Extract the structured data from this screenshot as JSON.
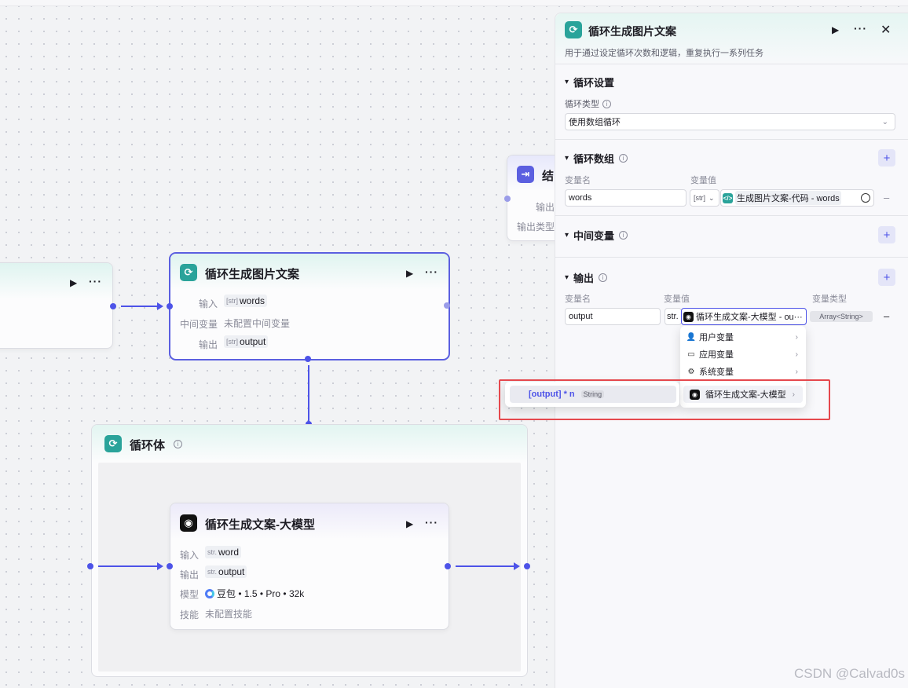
{
  "canvas": {
    "left_node": {},
    "end_node": {
      "title": "结",
      "output_label": "输出",
      "output_type_label": "输出类型"
    },
    "loop_node": {
      "title": "循环生成图片文案",
      "input_label": "输入",
      "input_type": "[str]",
      "input_value": "words",
      "mid_label": "中间变量",
      "mid_value": "未配置中间变量",
      "output_label": "输出",
      "output_type": "[str]",
      "output_value": "output"
    },
    "loop_body": {
      "title": "循环体"
    },
    "llm_node": {
      "title": "循环生成文案-大模型",
      "input_label": "输入",
      "input_type": "str.",
      "input_value": "word",
      "output_label": "输出",
      "output_type": "str.",
      "output_value": "output",
      "model_label": "模型",
      "model_value": "豆包 • 1.5 • Pro • 32k",
      "skill_label": "技能",
      "skill_value": "未配置技能"
    }
  },
  "panel": {
    "title": "循环生成图片文案",
    "description": "用于通过设定循环次数和逻辑，重复执行一系列任务",
    "loop_settings": {
      "title": "循环设置",
      "type_label": "循环类型",
      "type_value": "使用数组循环"
    },
    "loop_array": {
      "title": "循环数组",
      "name_col": "变量名",
      "value_col": "变量值",
      "name_value": "words",
      "type_tag": "[str]",
      "ref_value": "生成图片文案-代码 - words"
    },
    "mid_vars": {
      "title": "中间变量"
    },
    "output": {
      "title": "输出",
      "name_col": "变量名",
      "value_col": "变量值",
      "type_col": "变量类型",
      "name_value": "output",
      "type_prefix": "str.",
      "ref_value": "循环生成文案-大模型 - ou···",
      "var_type": "Array<String>"
    }
  },
  "dropdown": {
    "items": [
      "用户变量",
      "应用变量",
      "系统变量",
      "循环生成文案-大模型"
    ]
  },
  "submenu": {
    "item_label": "[output] * n",
    "item_type": "String"
  },
  "watermark": "CSDN @Calvad0s",
  "colors": {
    "accent": "#4d53e8",
    "loop_icon": "#2aa39a",
    "highlight": "#e5484d"
  }
}
